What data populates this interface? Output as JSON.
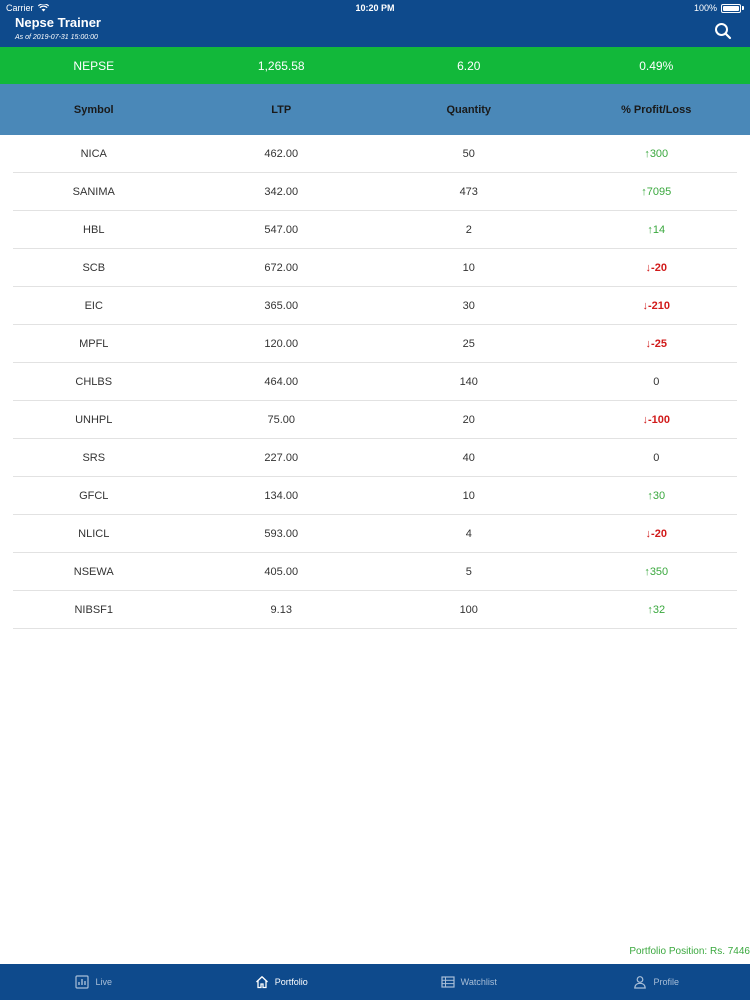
{
  "status_bar": {
    "carrier": "Carrier",
    "time": "10:20 PM",
    "battery": "100%"
  },
  "header": {
    "title": "Nepse Trainer",
    "subtitle": "As of 2019-07-31 15:00:00",
    "search_icon": "search-icon"
  },
  "index": {
    "name": "NEPSE",
    "value": "1,265.58",
    "change": "6.20",
    "percent": "0.49%",
    "color": "#12b83a"
  },
  "columns": {
    "symbol": "Symbol",
    "ltp": "LTP",
    "quantity": "Quantity",
    "pl": "% Profit/Loss"
  },
  "rows": [
    {
      "symbol": "NICA",
      "ltp": "462.00",
      "quantity": "50",
      "pl": "↑300",
      "dir": "up"
    },
    {
      "symbol": "SANIMA",
      "ltp": "342.00",
      "quantity": "473",
      "pl": "↑7095",
      "dir": "up"
    },
    {
      "symbol": "HBL",
      "ltp": "547.00",
      "quantity": "2",
      "pl": "↑14",
      "dir": "up"
    },
    {
      "symbol": "SCB",
      "ltp": "672.00",
      "quantity": "10",
      "pl": "↓-20",
      "dir": "down"
    },
    {
      "symbol": "EIC",
      "ltp": "365.00",
      "quantity": "30",
      "pl": "↓-210",
      "dir": "down"
    },
    {
      "symbol": "MPFL",
      "ltp": "120.00",
      "quantity": "25",
      "pl": "↓-25",
      "dir": "down"
    },
    {
      "symbol": "CHLBS",
      "ltp": "464.00",
      "quantity": "140",
      "pl": "0",
      "dir": "zero"
    },
    {
      "symbol": "UNHPL",
      "ltp": "75.00",
      "quantity": "20",
      "pl": "↓-100",
      "dir": "down"
    },
    {
      "symbol": "SRS",
      "ltp": "227.00",
      "quantity": "40",
      "pl": "0",
      "dir": "zero"
    },
    {
      "symbol": "GFCL",
      "ltp": "134.00",
      "quantity": "10",
      "pl": "↑30",
      "dir": "up"
    },
    {
      "symbol": "NLICL",
      "ltp": "593.00",
      "quantity": "4",
      "pl": "↓-20",
      "dir": "down"
    },
    {
      "symbol": "NSEWA",
      "ltp": "405.00",
      "quantity": "5",
      "pl": "↑350",
      "dir": "up"
    },
    {
      "symbol": "NIBSF1",
      "ltp": "9.13",
      "quantity": "100",
      "pl": "↑32",
      "dir": "up"
    }
  ],
  "footer": {
    "portfolio_position": "Portfolio Position: Rs. 7446"
  },
  "tabs": [
    {
      "label": "Live",
      "icon": "chart-icon",
      "active": false
    },
    {
      "label": "Portfolio",
      "icon": "home-icon",
      "active": true
    },
    {
      "label": "Watchlist",
      "icon": "list-icon",
      "active": false
    },
    {
      "label": "Profile",
      "icon": "person-icon",
      "active": false
    }
  ],
  "colors": {
    "header": "#0e4a8c",
    "index_bar": "#12b83a",
    "column_header": "#4a88b8",
    "profit": "#3aa83e",
    "loss": "#d11a1a"
  }
}
